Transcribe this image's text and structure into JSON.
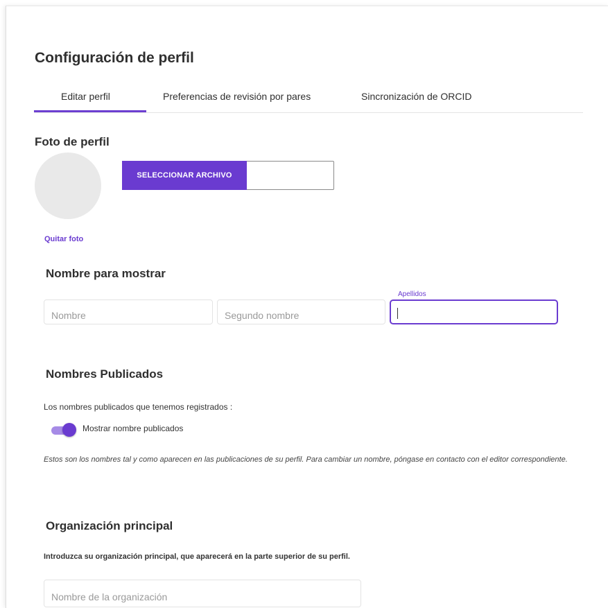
{
  "page": {
    "title": "Configuración de perfil"
  },
  "tabs": [
    {
      "label": "Editar perfil",
      "active": true
    },
    {
      "label": "Preferencias de revisión por pares",
      "active": false
    },
    {
      "label": "Sincronización de ORCID",
      "active": false
    }
  ],
  "accent_color": "#6a3bd0",
  "photo": {
    "label": "Foto de perfil",
    "select_button": "SELECCIONAR ARCHIVO",
    "remove_link": "Quitar foto"
  },
  "display_name": {
    "heading": "Nombre para mostrar",
    "first_name_placeholder": "Nombre",
    "middle_name_placeholder": "Segundo nombre",
    "last_name_label": "Apellidos",
    "last_name_value": ""
  },
  "published_names": {
    "heading": "Nombres Publicados",
    "description": "Los nombres publicados que tenemos registrados :",
    "toggle_label": "Mostrar nombre publicados",
    "toggle_on": true,
    "note": "Estos son los nombres tal y como aparecen en las publicaciones de su perfil. Para cambiar un nombre, póngase en contacto con el editor correspondiente."
  },
  "organization": {
    "heading": "Organización principal",
    "description": "Introduzca su organización principal, que aparecerá en la parte superior de su perfil.",
    "placeholder": "Nombre de la organización"
  }
}
